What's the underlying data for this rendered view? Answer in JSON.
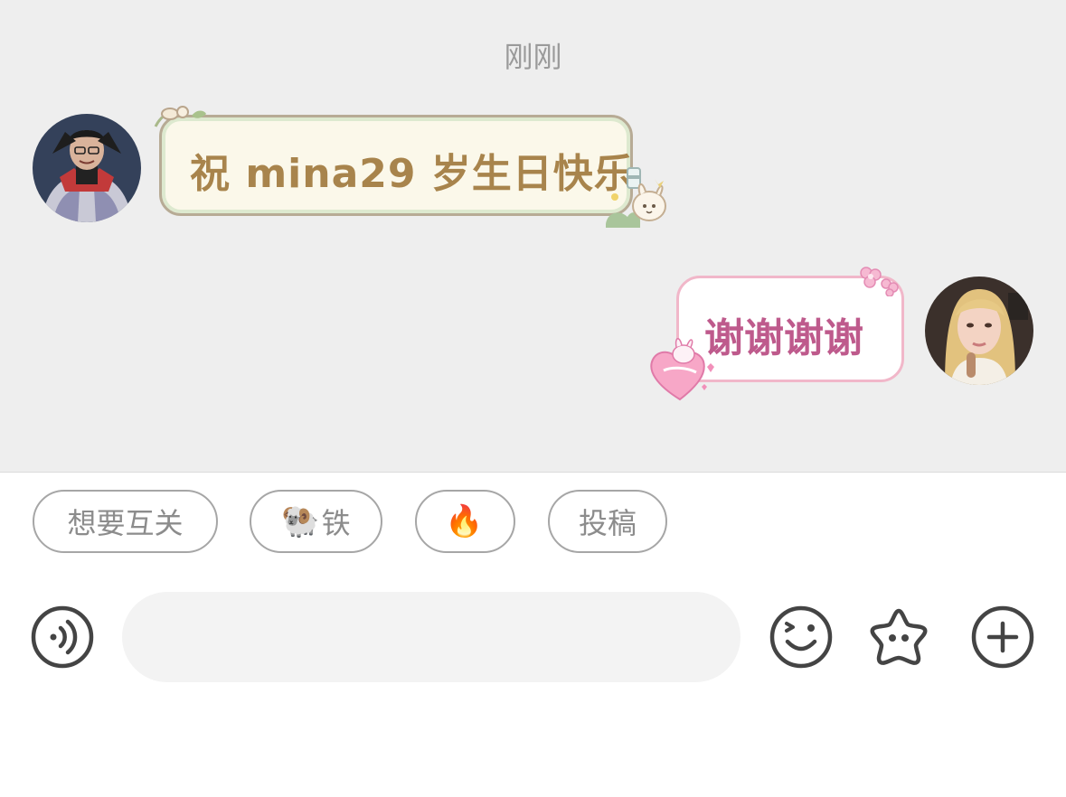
{
  "chat": {
    "timestamp": "刚刚",
    "messages": [
      {
        "side": "left",
        "text": "祝 mina29 岁生日快乐"
      },
      {
        "side": "right",
        "text": "谢谢谢谢"
      }
    ]
  },
  "quick_replies": [
    {
      "label": "想要互关"
    },
    {
      "emoji": "🐏",
      "label": "铁"
    },
    {
      "emoji": "🔥",
      "label": ""
    },
    {
      "label": "投稿"
    }
  ],
  "composer": {
    "placeholder": "",
    "value": ""
  },
  "icons": {
    "voice": "voice-icon",
    "emoji": "emoji-face-icon",
    "sticker": "star-sticker-icon",
    "plus": "plus-icon"
  },
  "colors": {
    "chat_background": "#eeeeee",
    "incoming_text": "#a8844c",
    "outgoing_text": "#be5a8c",
    "icon_stroke": "#444444"
  }
}
